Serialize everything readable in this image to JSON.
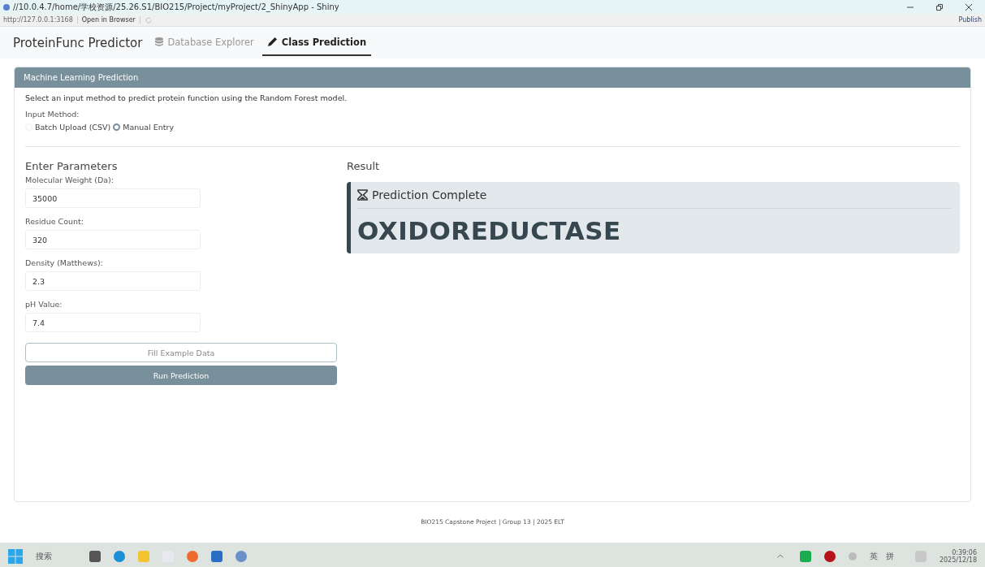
{
  "window": {
    "title": "//10.0.4.7/home/学校资源/25.26.S1/BIO215/Project/myProject/2_ShinyApp - Shiny",
    "url": "http://127.0.0.1:3168",
    "open_in_browser": "Open in Browser",
    "publish": "Publish"
  },
  "navbar": {
    "brand": "ProteinFunc Predictor",
    "tabs": [
      {
        "label": "Database Explorer",
        "selected": false
      },
      {
        "label": "Class Prediction",
        "selected": true
      }
    ]
  },
  "card": {
    "header": "Machine Learning Prediction",
    "description": "Select an input method to predict protein function using the Random Forest model.",
    "input_method_label": "Input Method:",
    "input_methods": [
      {
        "label": "Batch Upload (CSV)",
        "selected": false
      },
      {
        "label": "Manual Entry",
        "selected": true
      }
    ],
    "parameters_title": "Enter Parameters",
    "fields": [
      {
        "label": "Molecular Weight (Da):",
        "value": "35000"
      },
      {
        "label": "Residue Count:",
        "value": "320"
      },
      {
        "label": "Density (Matthews):",
        "value": "2.3"
      },
      {
        "label": "pH Value:",
        "value": "7.4"
      }
    ],
    "buttons": [
      {
        "label": "Fill Example Data",
        "kind": "outline"
      },
      {
        "label": "Run Prediction",
        "kind": "primary"
      }
    ],
    "result_title": "Result",
    "result": {
      "status": "Prediction Complete",
      "prediction": "OXIDOREDUCTASE"
    }
  },
  "footer": "BIO215 Capstone Project | Group 13 | 2025 ELT",
  "taskbar": {
    "search": "搜索",
    "tray": [
      "英",
      "拼"
    ],
    "time": "0:39:06",
    "date": "2025/12/18"
  }
}
